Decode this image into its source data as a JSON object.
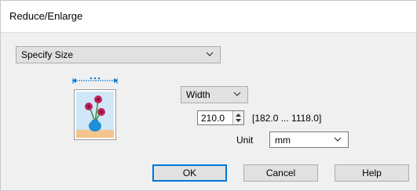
{
  "dialog": {
    "title": "Reduce/Enlarge"
  },
  "mode_select": {
    "value": "Specify Size"
  },
  "dimension_select": {
    "value": "Width"
  },
  "size_input": {
    "value": "210.0"
  },
  "range_text": "[182.0 ... 1118.0]",
  "unit": {
    "label": "Unit",
    "value": "mm"
  },
  "buttons": {
    "ok": "OK",
    "cancel": "Cancel",
    "help": "Help"
  },
  "colors": {
    "accent": "#0078d7",
    "preview_bg": "#cfe7f7",
    "table": "#f3c48b",
    "flower": "#c0245c",
    "vase": "#1e8fd6"
  }
}
